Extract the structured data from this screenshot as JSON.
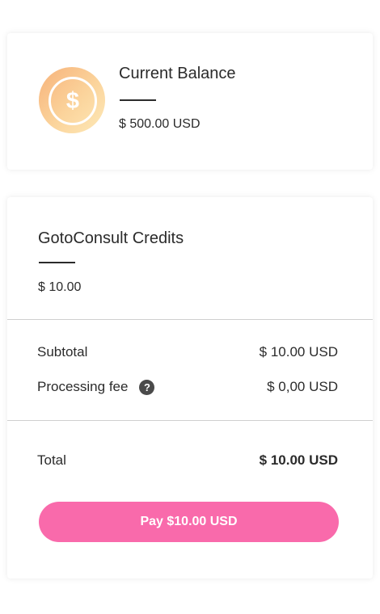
{
  "balance": {
    "title": "Current Balance",
    "value": "$ 500.00 USD",
    "icon": "dollar-coin-icon",
    "icon_glyph": "$"
  },
  "credits": {
    "title": "GotoConsult Credits",
    "value": "$ 10.00"
  },
  "summary": {
    "subtotal_label": "Subtotal",
    "subtotal_value": "$ 10.00 USD",
    "fee_label": "Processing fee",
    "fee_help_icon": "question-circle-icon",
    "fee_help_glyph": "?",
    "fee_value": "$ 0,00 USD",
    "total_label": "Total",
    "total_value": "$ 10.00 USD"
  },
  "pay_button": {
    "label": "Pay $10.00 USD"
  },
  "colors": {
    "pay_button": "#f96aab",
    "coin_gradient_start": "#f7b27a",
    "coin_gradient_end": "#fde9b8",
    "text": "#2b2b2b"
  }
}
